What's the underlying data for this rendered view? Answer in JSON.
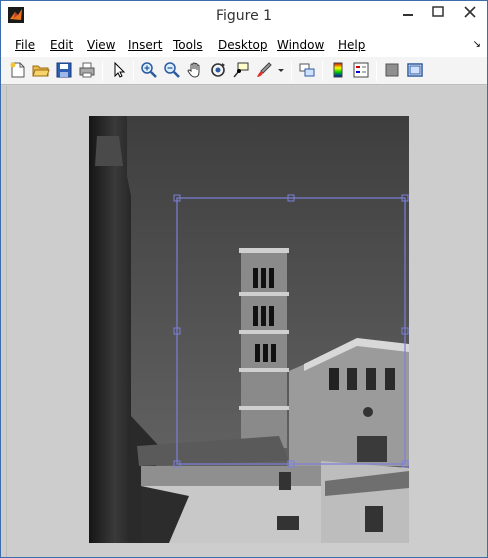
{
  "window": {
    "title": "Figure 1"
  },
  "menu": {
    "items": [
      {
        "label": "File"
      },
      {
        "label": "Edit"
      },
      {
        "label": "View"
      },
      {
        "label": "Insert"
      },
      {
        "label": "Tools"
      },
      {
        "label": "Desktop"
      },
      {
        "label": "Window"
      },
      {
        "label": "Help"
      }
    ]
  },
  "toolbar": {
    "buttons": [
      "new-figure-icon",
      "open-file-icon",
      "save-icon",
      "print-icon",
      "edit-plot-arrow-icon",
      "zoom-in-icon",
      "zoom-out-icon",
      "pan-hand-icon",
      "rotate-3d-icon",
      "data-cursor-icon",
      "brush-icon",
      "brush-dropdown-icon",
      "link-plot-icon",
      "colorbar-icon",
      "legend-icon",
      "hide-plot-tools-icon",
      "show-plot-tools-icon"
    ]
  },
  "figure": {
    "content": "grayscale photo with rectangular crop selection",
    "selection_color": "#7b7fd8"
  }
}
